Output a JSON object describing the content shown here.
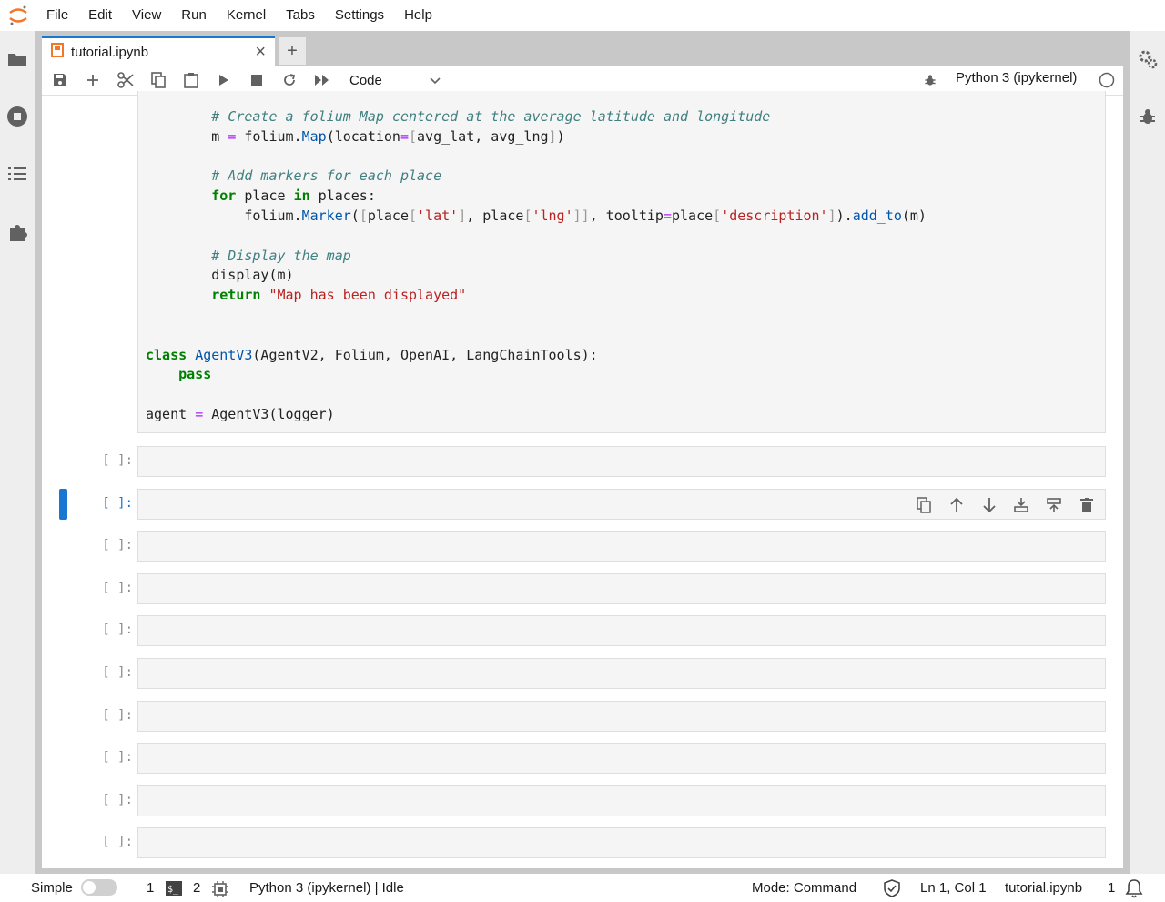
{
  "menu": [
    "File",
    "Edit",
    "View",
    "Run",
    "Kernel",
    "Tabs",
    "Settings",
    "Help"
  ],
  "tab": {
    "label": "tutorial.ipynb",
    "close": "×",
    "new_tab": "+"
  },
  "toolbar": {
    "cell_type": "Code",
    "kernel": "Python 3 (ipykernel)"
  },
  "code_lines": [
    "        # Create a folium Map centered at the average latitude and longitude",
    "        m = folium.Map(location=[avg_lat, avg_lng])",
    "",
    "        # Add markers for each place",
    "        for place in places:",
    "            folium.Marker([place['lat'], place['lng']], tooltip=place['description']).add_to(m)",
    "",
    "        # Display the map",
    "        display(m)",
    "        return \"Map has been displayed\"",
    "",
    "",
    "class AgentV3(AgentV2, Folium, OpenAI, LangChainTools):",
    "    pass",
    "",
    "agent = AgentV3(logger)"
  ],
  "empty_cells": [
    {
      "prompt": "[ ]:",
      "active": false
    },
    {
      "prompt": "[ ]:",
      "active": true
    },
    {
      "prompt": "[ ]:",
      "active": false
    },
    {
      "prompt": "[ ]:",
      "active": false
    },
    {
      "prompt": "[ ]:",
      "active": false
    },
    {
      "prompt": "[ ]:",
      "active": false
    },
    {
      "prompt": "[ ]:",
      "active": false
    },
    {
      "prompt": "[ ]:",
      "active": false
    },
    {
      "prompt": "[ ]:",
      "active": false
    },
    {
      "prompt": "[ ]:",
      "active": false
    }
  ],
  "status": {
    "mode_label": "Simple",
    "terminals": "1",
    "kernels": "2",
    "kernel_status": "Python 3 (ipykernel) | Idle",
    "mode": "Mode: Command",
    "position": "Ln 1, Col 1",
    "file": "tutorial.ipynb",
    "notifications": "1"
  },
  "colors": {
    "accent": "#1976d2",
    "keyword": "#008000",
    "string": "#ba2121",
    "comment": "#408080"
  }
}
